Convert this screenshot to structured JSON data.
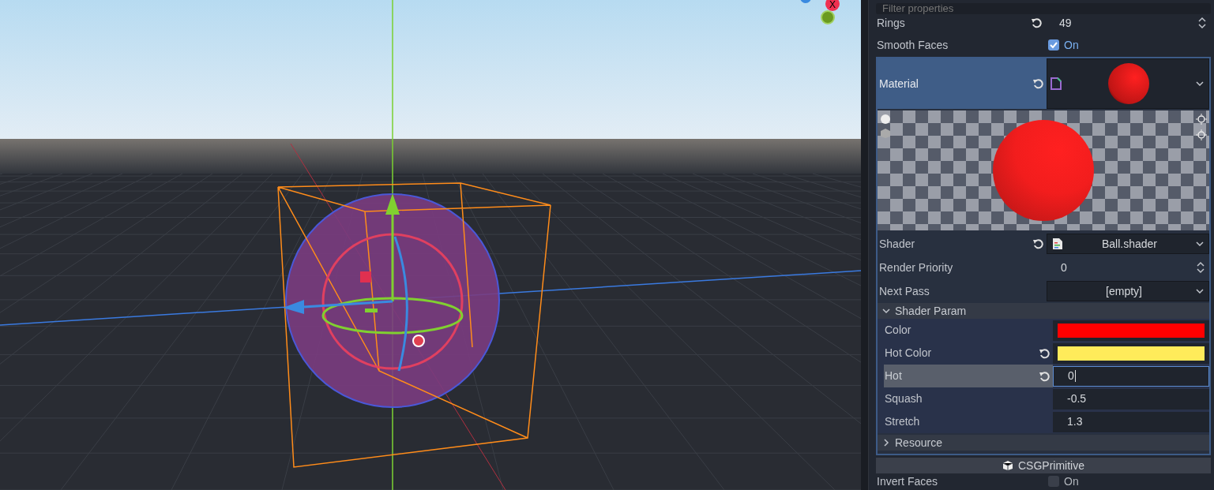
{
  "viewport": {
    "axis_label": "X"
  },
  "filter": {
    "placeholder": "Filter properties"
  },
  "properties": [
    {
      "kind": "spin",
      "label": "Rings",
      "value": "49",
      "revertable": true
    },
    {
      "kind": "check",
      "label": "Smooth Faces",
      "checked": true,
      "value_label": "On",
      "revertable": false
    }
  ],
  "material": {
    "label": "Material",
    "revertable": true,
    "selected": true
  },
  "material_properties": [
    {
      "kind": "resource",
      "label": "Shader",
      "value": "Ball.shader",
      "revertable": true
    },
    {
      "kind": "spin",
      "label": "Render Priority",
      "value": "0",
      "revertable": false
    },
    {
      "kind": "resource",
      "label": "Next Pass",
      "value": "[empty]",
      "revertable": false
    }
  ],
  "shader_param": {
    "label": "Shader Param",
    "expanded": true,
    "params": [
      {
        "kind": "color",
        "label": "Color",
        "color": "#ff0000",
        "revertable": false,
        "selected": false
      },
      {
        "kind": "color",
        "label": "Hot Color",
        "color": "#ffeb5a",
        "revertable": true,
        "selected": false
      },
      {
        "kind": "text",
        "label": "Hot",
        "value": "0",
        "revertable": true,
        "selected": true
      },
      {
        "kind": "text",
        "label": "Squash",
        "value": "-0.5",
        "revertable": false,
        "selected": false
      },
      {
        "kind": "text",
        "label": "Stretch",
        "value": "1.3",
        "revertable": false,
        "selected": false
      }
    ]
  },
  "resource": {
    "label": "Resource",
    "expanded": false
  },
  "category": {
    "label": "CSGPrimitive"
  },
  "after": [
    {
      "kind": "check",
      "label": "Invert Faces",
      "checked": false,
      "value_label": "On",
      "revertable": false
    }
  ]
}
